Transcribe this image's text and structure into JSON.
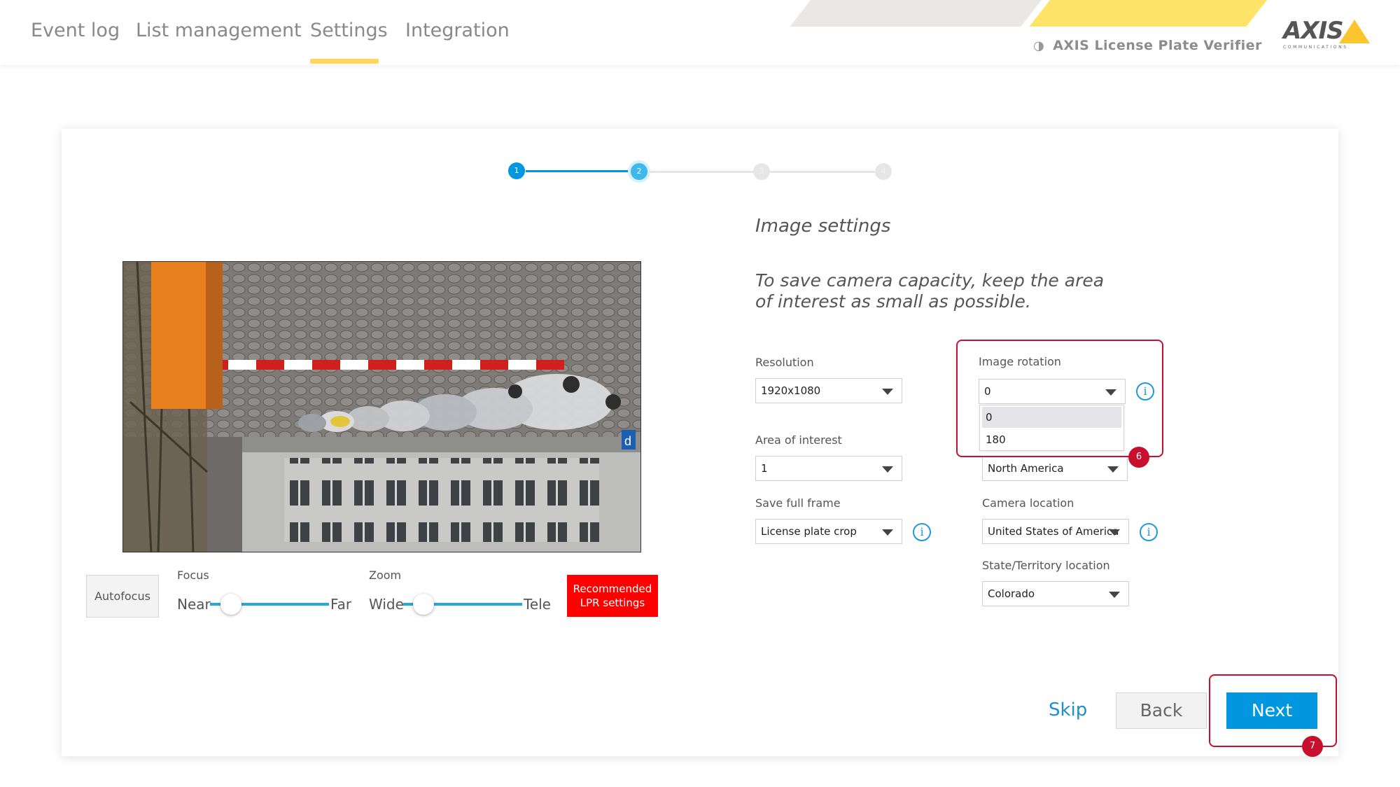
{
  "nav": {
    "tabs": [
      {
        "label": "Event log"
      },
      {
        "label": "List management"
      },
      {
        "label": "Settings"
      },
      {
        "label": "Integration"
      }
    ],
    "active_tab": "Settings"
  },
  "brand": {
    "app_name": "AXIS License Plate Verifier",
    "logo_word": "AXIS",
    "logo_sub": "COMMUNICATIONS",
    "colors": {
      "accent_yellow": "#fde468",
      "stripe_gray": "#ebe7e4",
      "logo_triangle": "#fcc52e"
    }
  },
  "stepper": {
    "steps": [
      "1",
      "2",
      "3",
      "4"
    ],
    "current_step": 2,
    "colors": {
      "done": "#0097e0",
      "current": "#3fb8ec",
      "pending": "#e6e6e6"
    }
  },
  "preview": {
    "controls": {
      "autofocus_label": "Autofocus",
      "focus_label": "Focus",
      "focus_min": "Near",
      "focus_max": "Far",
      "zoom_label": "Zoom",
      "zoom_min": "Wide",
      "zoom_max": "Tele",
      "recommended_label": "Recommended LPR settings"
    }
  },
  "form": {
    "title": "Image settings",
    "hint": "To save camera capacity, keep the area of interest as small as possible.",
    "resolution": {
      "label": "Resolution",
      "value": "1920x1080"
    },
    "area_of_interest": {
      "label": "Area of interest",
      "value": "1"
    },
    "save_full_frame": {
      "label": "Save full frame",
      "value": "License plate crop"
    },
    "image_rotation": {
      "label": "Image rotation",
      "value": "0",
      "options": [
        "0",
        "180"
      ],
      "selected_option": "0"
    },
    "region": {
      "value": "North America"
    },
    "camera_location": {
      "label": "Camera location",
      "value": "United States of America"
    },
    "state_location": {
      "label": "State/Territory location",
      "value": "Colorado"
    },
    "info_glyph": "i"
  },
  "annotations": {
    "marker_rotation": "6",
    "marker_next": "7",
    "color": "#c8102e"
  },
  "footer": {
    "skip_label": "Skip",
    "back_label": "Back",
    "next_label": "Next"
  }
}
